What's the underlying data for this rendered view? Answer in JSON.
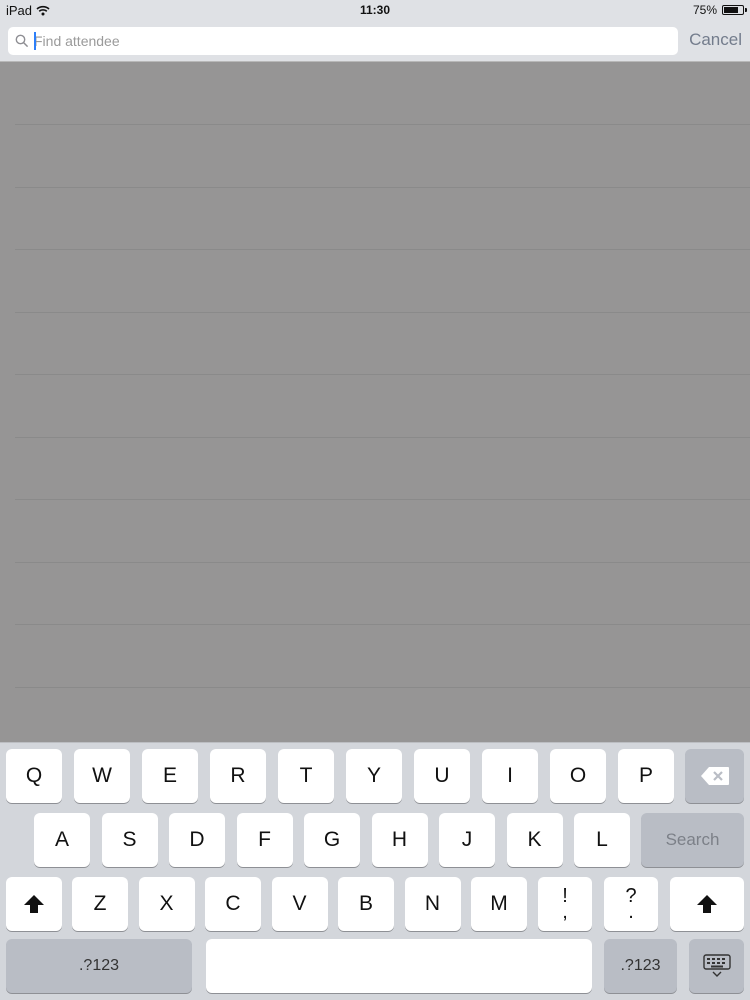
{
  "status_bar": {
    "device": "iPad",
    "time": "11:30",
    "battery_percent": "75%",
    "battery_level": 0.75
  },
  "search": {
    "placeholder": "Find attendee",
    "value": "",
    "cancel_label": "Cancel"
  },
  "results": {
    "row_count": 10
  },
  "keyboard": {
    "row1": [
      "Q",
      "W",
      "E",
      "R",
      "T",
      "Y",
      "U",
      "I",
      "O",
      "P"
    ],
    "row2": [
      "A",
      "S",
      "D",
      "F",
      "G",
      "H",
      "J",
      "K",
      "L"
    ],
    "row3": [
      "Z",
      "X",
      "C",
      "V",
      "B",
      "N",
      "M"
    ],
    "punct1": {
      "top": "!",
      "bottom": ","
    },
    "punct2": {
      "top": "?",
      "bottom": "."
    },
    "search_label": "Search",
    "numbers_label": ".?123",
    "icons": {
      "backspace": "backspace-icon",
      "shift": "shift-icon",
      "dismiss": "keyboard-dismiss-icon"
    }
  },
  "colors": {
    "accent": "#2d7ff9",
    "bar_bg": "#dfe1e5",
    "dim_bg": "#969595"
  }
}
